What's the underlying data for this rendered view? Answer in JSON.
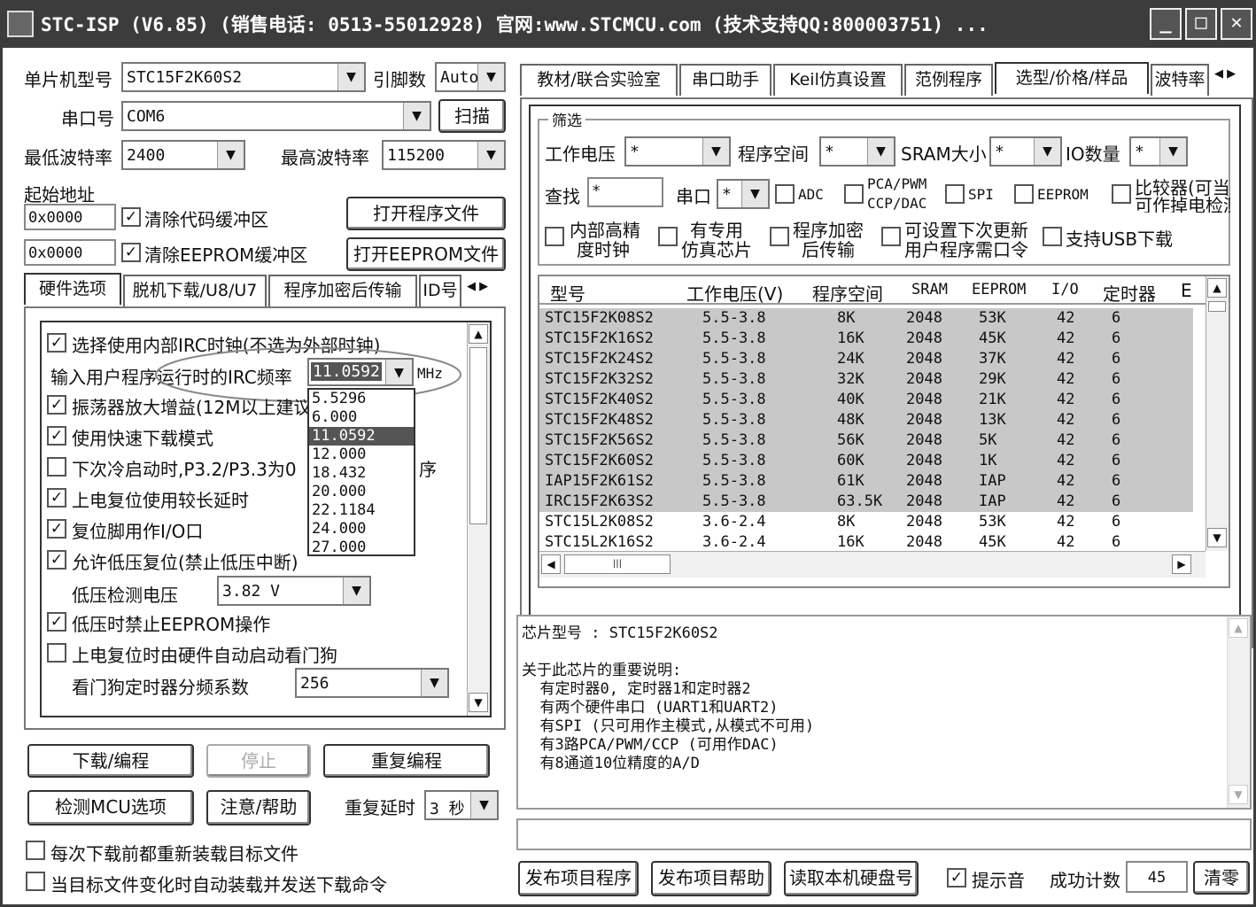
{
  "window": {
    "title": "STC-ISP (V6.85) (销售电话: 0513-55012928) 官网:www.STCMCU.com (技术支持QQ:800003751) ..."
  },
  "left": {
    "mcu_label": "单片机型号",
    "mcu_value": "STC15F2K60S2",
    "pin_label": "引脚数",
    "pin_value": "Auto",
    "port_label": "串口号",
    "port_value": "COM6",
    "scan_button": "扫描",
    "min_baud_label": "最低波特率",
    "min_baud_value": "2400",
    "max_baud_label": "最高波特率",
    "max_baud_value": "115200",
    "start_addr_label": "起始地址",
    "addr1": "0x0000",
    "clear_code_label": "清除代码缓冲区",
    "open_prog_button": "打开程序文件",
    "addr2": "0x0000",
    "clear_eeprom_label": "清除EEPROM缓冲区",
    "open_eeprom_button": "打开EEPROM文件"
  },
  "left_tabs": [
    "硬件选项",
    "脱机下载/U8/U7",
    "程序加密后传输",
    "ID号"
  ],
  "hw": {
    "opt_irc": "选择使用内部IRC时钟(不选为外部时钟)",
    "irc_freq_label": "输入用户程序运行时的IRC频率",
    "irc_freq_value": "11.0592",
    "mhz": "MHz",
    "freq_options": [
      "5.5296",
      "6.000",
      "11.0592",
      "12.000",
      "18.432",
      "20.000",
      "22.1184",
      "24.000",
      "27.000"
    ],
    "opt_osc": "振荡器放大增益(12M以上建议",
    "opt_fast": "使用快速下载模式",
    "opt_p32": "下次冷启动时,P3.2/P3.3为0",
    "opt_p32_tail": "序",
    "opt_reset_delay": "上电复位使用较长延时",
    "opt_reset_io": "复位脚用作I/O口",
    "opt_lowv": "允许低压复位(禁止低压中断)",
    "lowv_label": "低压检测电压",
    "lowv_value": "3.82 V",
    "opt_lowv_eeprom": "低压时禁止EEPROM操作",
    "opt_wdt": "上电复位时由硬件自动启动看门狗",
    "wdt_label": "看门狗定时器分频系数",
    "wdt_value": "256"
  },
  "actions": {
    "download": "下载/编程",
    "stop": "停止",
    "reprogram": "重复编程",
    "detect": "检测MCU选项",
    "help": "注意/帮助",
    "repeat_delay_label": "重复延时",
    "repeat_delay_value": "3 秒",
    "reload_label": "每次下载前都重新装载目标文件",
    "auto_label": "当目标文件变化时自动装载并发送下载命令"
  },
  "right_tabs": [
    "教材/联合实验室",
    "串口助手",
    "Keil仿真设置",
    "范例程序",
    "选型/价格/样品",
    "波特率"
  ],
  "filter": {
    "group": "筛选",
    "voltage_label": "工作电压",
    "voltage_value": "*",
    "prog_label": "程序空间",
    "prog_value": "*",
    "sram_label": "SRAM大小",
    "sram_value": "*",
    "io_label": "IO数量",
    "io_value": "*",
    "find_label": "查找",
    "find_value": "*",
    "uart_label": "串口",
    "uart_value": "*",
    "adc": "ADC",
    "pca1": "PCA/PWM",
    "pca2": "CCP/DAC",
    "spi": "SPI",
    "eeprom": "EEPROM",
    "cmp1": "比较器(可当",
    "cmp2": "可作掉电检测",
    "irc1": "内部高精",
    "irc2": "度时钟",
    "emu1": "有专用",
    "emu2": "仿真芯片",
    "enc1": "程序加密",
    "enc2": "后传输",
    "upd1": "可设置下次更新",
    "upd2": "用户程序需口令",
    "usb": "支持USB下载"
  },
  "table": {
    "headers": [
      "型号",
      "工作电压(V)",
      "程序空间",
      "SRAM",
      "EEPROM",
      "I/O",
      "定时器",
      "E"
    ],
    "rows": [
      [
        "STC15F2K08S2",
        "5.5-3.8",
        "8K",
        "2048",
        "53K",
        "42",
        "6"
      ],
      [
        "STC15F2K16S2",
        "5.5-3.8",
        "16K",
        "2048",
        "45K",
        "42",
        "6"
      ],
      [
        "STC15F2K24S2",
        "5.5-3.8",
        "24K",
        "2048",
        "37K",
        "42",
        "6"
      ],
      [
        "STC15F2K32S2",
        "5.5-3.8",
        "32K",
        "2048",
        "29K",
        "42",
        "6"
      ],
      [
        "STC15F2K40S2",
        "5.5-3.8",
        "40K",
        "2048",
        "21K",
        "42",
        "6"
      ],
      [
        "STC15F2K48S2",
        "5.5-3.8",
        "48K",
        "2048",
        "13K",
        "42",
        "6"
      ],
      [
        "STC15F2K56S2",
        "5.5-3.8",
        "56K",
        "2048",
        "5K",
        "42",
        "6"
      ],
      [
        "STC15F2K60S2",
        "5.5-3.8",
        "60K",
        "2048",
        "1K",
        "42",
        "6"
      ],
      [
        "IAP15F2K61S2",
        "5.5-3.8",
        "61K",
        "2048",
        "IAP",
        "42",
        "6"
      ],
      [
        "IRC15F2K63S2",
        "5.5-3.8",
        "63.5K",
        "2048",
        "IAP",
        "42",
        "6"
      ],
      [
        "STC15L2K08S2",
        "3.6-2.4",
        "8K",
        "2048",
        "53K",
        "42",
        "6"
      ],
      [
        "STC15L2K16S2",
        "3.6-2.4",
        "16K",
        "2048",
        "45K",
        "42",
        "6"
      ]
    ]
  },
  "info": {
    "lines": [
      "芯片型号 : STC15F2K60S2",
      "",
      "关于此芯片的重要说明:",
      "  有定时器0, 定时器1和定时器2",
      "  有两个硬件串口 (UART1和UART2)",
      "  有SPI (只可用作主模式,从模式不可用)",
      "  有3路PCA/PWM/CCP (可用作DAC)",
      "  有8通道10位精度的A/D"
    ]
  },
  "bottom": {
    "publish_prog": "发布项目程序",
    "publish_help": "发布项目帮助",
    "read_disk": "读取本机硬盘号",
    "beep_label": "提示音",
    "count_label": "成功计数",
    "count_value": "45",
    "clear": "清零"
  }
}
